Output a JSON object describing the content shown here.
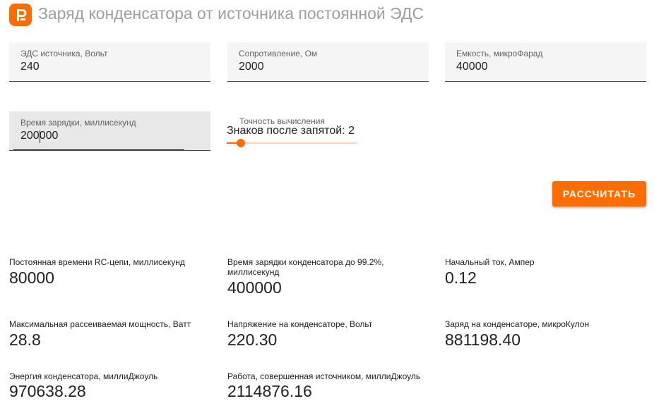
{
  "header": {
    "title": "Заряд конденсатора от источника постоянной ЭДС",
    "logo_icon": "p-logo-icon",
    "accent_color": "#ff6d00"
  },
  "inputs": {
    "emf": {
      "label": "ЭДС источника, Вольт",
      "value": "240"
    },
    "resistance": {
      "label": "Сопротивление, Ом",
      "value": "2000"
    },
    "capacitance": {
      "label": "Емкость, микроФарад",
      "value": "40000"
    },
    "charge_time": {
      "label": "Время зарядки, миллисекунд",
      "value": "200000"
    }
  },
  "precision": {
    "label": "Точность вычисления",
    "value_text": "Знаков после запятой: 2",
    "slider_level": 0.11
  },
  "calculate_button": {
    "label": "РАССЧИТАТЬ"
  },
  "results": {
    "time_constant": {
      "label": "Постоянная времени RC-цепи, миллисекунд",
      "value": "80000"
    },
    "full_charge_time": {
      "label": "Время зарядки конденсатора до 99.2%, миллисекунд",
      "value": "400000"
    },
    "initial_current": {
      "label": "Начальный ток, Ампер",
      "value": "0.12"
    },
    "max_power": {
      "label": "Максимальная рассеиваемая мощность, Ватт",
      "value": "28.8"
    },
    "cap_voltage": {
      "label": "Напряжение на конденсаторе, Вольт",
      "value": "220.30"
    },
    "cap_charge": {
      "label": "Заряд на конденсаторе, микроКулон",
      "value": "881198.40"
    },
    "cap_energy": {
      "label": "Энергия конденсатора, миллиДжоуль",
      "value": "970638.28"
    },
    "source_work": {
      "label": "Работа, совершенная источником, миллиДжоуль",
      "value": "2114876.16"
    }
  }
}
